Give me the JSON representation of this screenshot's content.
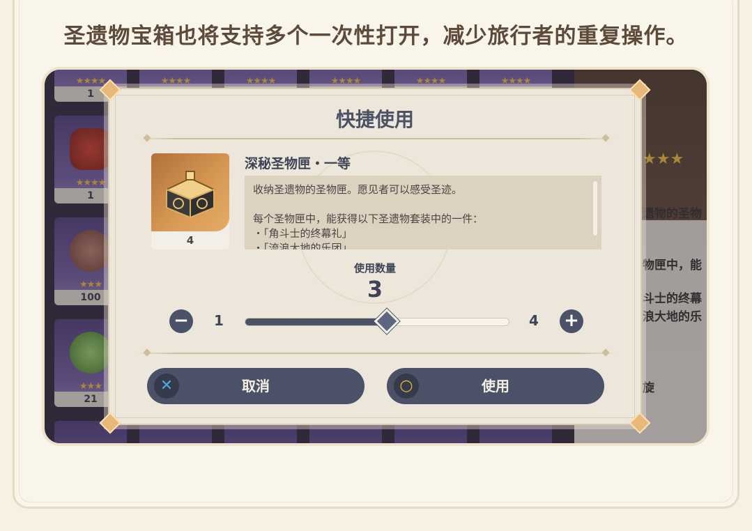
{
  "headline": "圣遗物宝箱也将支持多个一次性打开，减少旅行者的重复操作。",
  "background_inventory": {
    "cells": [
      {
        "count": "1",
        "stars": "★★★★"
      },
      {
        "count": "",
        "stars": "★★★★"
      },
      {
        "count": "",
        "stars": "★★★★"
      },
      {
        "count": "",
        "stars": "★★★★"
      },
      {
        "count": "",
        "stars": "★★★★"
      },
      {
        "count": "",
        "stars": "★★★★"
      },
      {
        "count": "1",
        "stars": "★★★★"
      },
      {
        "count": "100",
        "stars": "★★★"
      },
      {
        "count": "21",
        "stars": "★★★"
      }
    ],
    "side_panel": {
      "stars": "★★★",
      "lines": [
        "遗物的圣物",
        "物匣中，能",
        "斗士的终幕",
        "浪大地的乐",
        "旋"
      ]
    }
  },
  "dialog": {
    "title": "快捷使用",
    "item": {
      "name": "深秘圣物匣・一等",
      "count": "4",
      "description": [
        "收纳圣遗物的圣物匣。愿见者可以感受圣迹。",
        "",
        "每个圣物匣中，能获得以下圣遗物套装中的一件：",
        "・「角斗士的终幕礼」",
        "・「流浪大地的乐团」"
      ]
    },
    "quantity": {
      "label": "使用数量",
      "value": "3",
      "min": "1",
      "max": "4",
      "current": 3,
      "minus_icon": "minus-icon",
      "plus_icon": "plus-icon"
    },
    "buttons": {
      "cancel": {
        "label": "取消",
        "icon": "cross-icon",
        "icon_glyph": "✕"
      },
      "use": {
        "label": "使用",
        "icon": "circle-icon",
        "icon_glyph": "○"
      }
    }
  },
  "colors": {
    "button_bg": "#4b5268",
    "title_text": "#4b5266",
    "star": "#f4c542",
    "cross_accent": "#4fa8e6",
    "circle_accent": "#e8b83a"
  }
}
